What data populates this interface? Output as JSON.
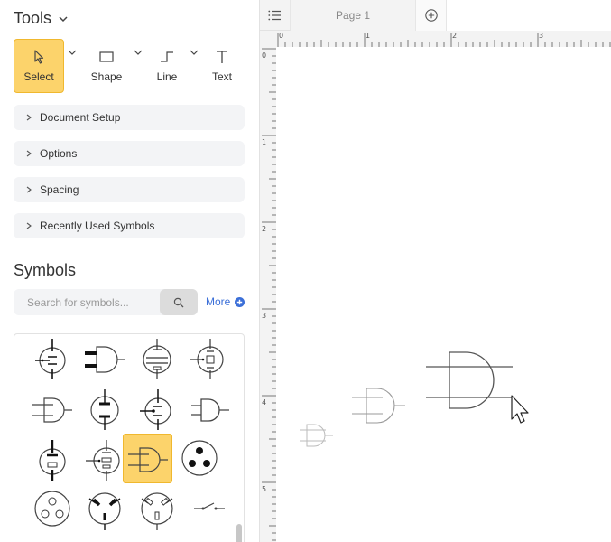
{
  "tools": {
    "title": "Tools",
    "items": [
      {
        "label": "Select",
        "icon": "cursor-arrow-icon",
        "active": true
      },
      {
        "label": "Shape",
        "icon": "rectangle-icon"
      },
      {
        "label": "Line",
        "icon": "elbow-line-icon"
      },
      {
        "label": "Text",
        "icon": "text-t-icon"
      }
    ]
  },
  "panels": [
    "Document Setup",
    "Options",
    "Spacing",
    "Recently Used Symbols"
  ],
  "symbols": {
    "title": "Symbols",
    "search_placeholder": "Search for symbols...",
    "more_label": "More",
    "grid": [
      "vacuum-tube-triode-icon",
      "bold-and-gate-icon",
      "vacuum-tube-tetrode-icon",
      "vacuum-tube-pentode-icon",
      "and-gate-outline-icon",
      "vacuum-tube-diode-icon",
      "vacuum-tube-dot-icon",
      "and-gate-small-icon",
      "vacuum-tube-split-icon",
      "vacuum-tube-side-icon",
      "and-gate-selected-icon",
      "three-dot-socket-icon",
      "three-circle-socket-icon",
      "angled-plug-socket-icon",
      "angled-slot-socket-icon",
      "switch-contact-icon"
    ],
    "selected_index": 10
  },
  "tabs": {
    "page_label": "Page 1",
    "menu_icon": "list-menu-icon",
    "add_icon": "add-page-plus-icon"
  },
  "ruler": {
    "h_labels": [
      "0",
      "1",
      "2",
      "3"
    ],
    "v_labels": [
      "0",
      "1",
      "2",
      "3",
      "4",
      "5"
    ]
  },
  "colors": {
    "accent": "#fcd36b",
    "link": "#3b6fd8",
    "panel_bg": "#f3f4f6"
  }
}
